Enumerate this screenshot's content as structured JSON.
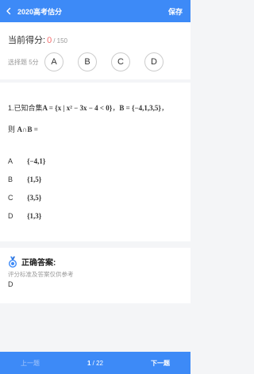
{
  "header": {
    "title": "2020高考估分",
    "save_label": "保存"
  },
  "score": {
    "label": "当前得分:",
    "value": "0",
    "total": "/ 150"
  },
  "choices": {
    "label": "选择题 5分",
    "options": [
      "A",
      "B",
      "C",
      "D"
    ]
  },
  "question": {
    "number": "1.",
    "prefix": "已知合集",
    "set_a": "A = {x | x² − 3x − 4 < 0}",
    "sep": "，",
    "set_b": "B = {−4,1,3,5}",
    "end": "，",
    "line2_prefix": "则",
    "line2_expr": "A∩B ="
  },
  "options": [
    {
      "letter": "A",
      "text": "{−4,1}"
    },
    {
      "letter": "B",
      "text": "{1,5}"
    },
    {
      "letter": "C",
      "text": "{3,5}"
    },
    {
      "letter": "D",
      "text": "{1,3}"
    }
  ],
  "answer": {
    "title": "正确答案:",
    "note": "评分标准及答案仅供参考",
    "value": "D"
  },
  "footer": {
    "prev_label": "上一题",
    "current": "1",
    "sep": " / ",
    "total": "22",
    "next_label": "下一题"
  },
  "colors": {
    "primary": "#3d8af7",
    "score": "#f56c6c"
  }
}
